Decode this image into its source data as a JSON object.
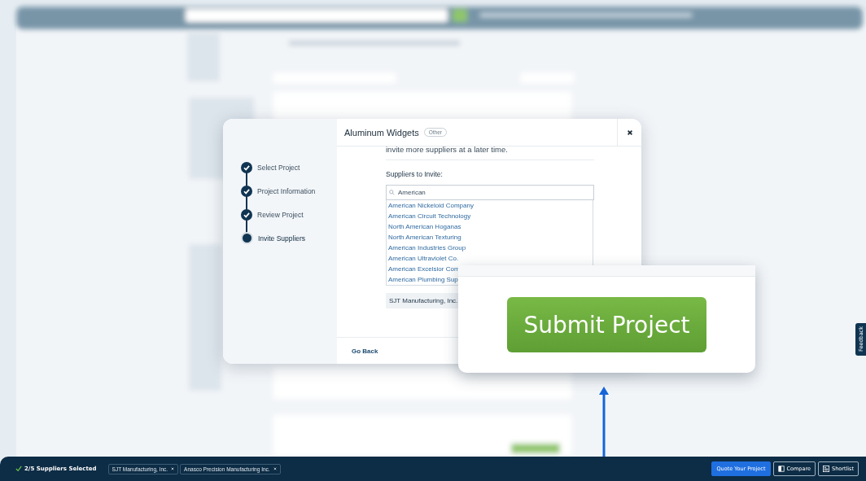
{
  "modal": {
    "title": "Aluminum Widgets",
    "tag": "Other",
    "steps": [
      {
        "label": "Select Project",
        "done": true,
        "selected": false
      },
      {
        "label": "Project Information",
        "done": true,
        "selected": false
      },
      {
        "label": "Review Project",
        "done": true,
        "selected": false
      },
      {
        "label": "Invite Suppliers",
        "done": false,
        "selected": true
      }
    ],
    "intro": "invite more suppliers at a later time.",
    "suppliers_label": "Suppliers to Invite:",
    "search": {
      "value": "American"
    },
    "results": [
      "American Nickeloid Company",
      "American Circuit Technology",
      "North American Hoganas",
      "North American Texturing",
      "American Industries Group",
      "American Ultraviolet Co.",
      "American Excelsior Com",
      "American Plumbing Sup"
    ],
    "selected_suppliers": [
      "SJT Manufacturing, Inc."
    ],
    "back_button": "Go Back"
  },
  "zoom_callout": {
    "button": "Submit Project"
  },
  "feedback_tab": "Feedback",
  "footer": {
    "count": "2/5 Suppliers Selected",
    "chips": [
      "SJT Manufacturing, Inc.",
      "Anasco Precision Manufacturing Inc."
    ],
    "buttons": [
      {
        "label": "Quote Your Project",
        "kind": "primary"
      },
      {
        "label": "Compare",
        "kind": "compare"
      },
      {
        "label": "Shortlist",
        "kind": "shortlist"
      }
    ]
  }
}
